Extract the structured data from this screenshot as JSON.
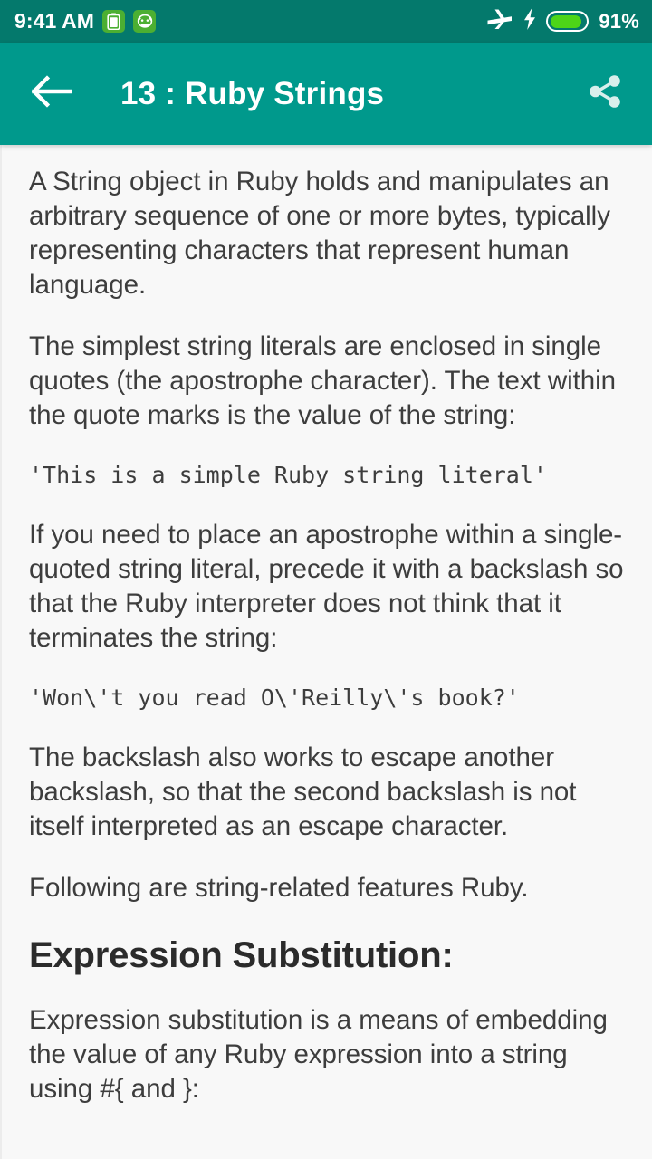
{
  "status_bar": {
    "clock": "9:41 AM",
    "battery_percent": "91%",
    "battery_level": 91,
    "icons": {
      "battery_saver": "battery-saver-icon",
      "app_notification": "cat-face-icon",
      "airplane_mode": "airplane-icon",
      "charging": "lightning-bolt-icon",
      "battery": "battery-icon"
    },
    "colors": {
      "background": "#04796c",
      "foreground": "#ffffff",
      "notification_chip": "#4caf32",
      "battery_fill": "#4dd518"
    }
  },
  "app_bar": {
    "back_icon": "arrow-left-icon",
    "title": "13 : Ruby Strings",
    "share_icon": "share-icon",
    "colors": {
      "background": "#00998c",
      "foreground": "#ffffff"
    }
  },
  "content": {
    "background": "#f8f8f8",
    "text_color": "#3d3d3d",
    "blocks": [
      {
        "type": "paragraph",
        "text": "A String object in Ruby holds and manipulates an arbitrary sequence of one or more bytes, typically representing characters that represent human language."
      },
      {
        "type": "paragraph",
        "text": "The simplest string literals are enclosed in single quotes (the apostrophe character). The text within the quote marks is the value of the string:"
      },
      {
        "type": "code",
        "text": "'This is a simple Ruby string literal'"
      },
      {
        "type": "paragraph",
        "text": "If you need to place an apostrophe within a single-quoted string literal, precede it with a backslash so that the Ruby interpreter does not think that it terminates the string:"
      },
      {
        "type": "code",
        "text": "'Won\\'t you read O\\'Reilly\\'s book?'"
      },
      {
        "type": "paragraph",
        "text": "The backslash also works to escape another backslash, so that the second backslash is not itself interpreted as an escape character."
      },
      {
        "type": "paragraph",
        "text": "Following are string-related features Ruby."
      },
      {
        "type": "heading",
        "text": "Expression Substitution:"
      },
      {
        "type": "paragraph",
        "text": "Expression substitution is a means of embedding the value of any Ruby expression into a string using #{ and }:"
      }
    ]
  }
}
